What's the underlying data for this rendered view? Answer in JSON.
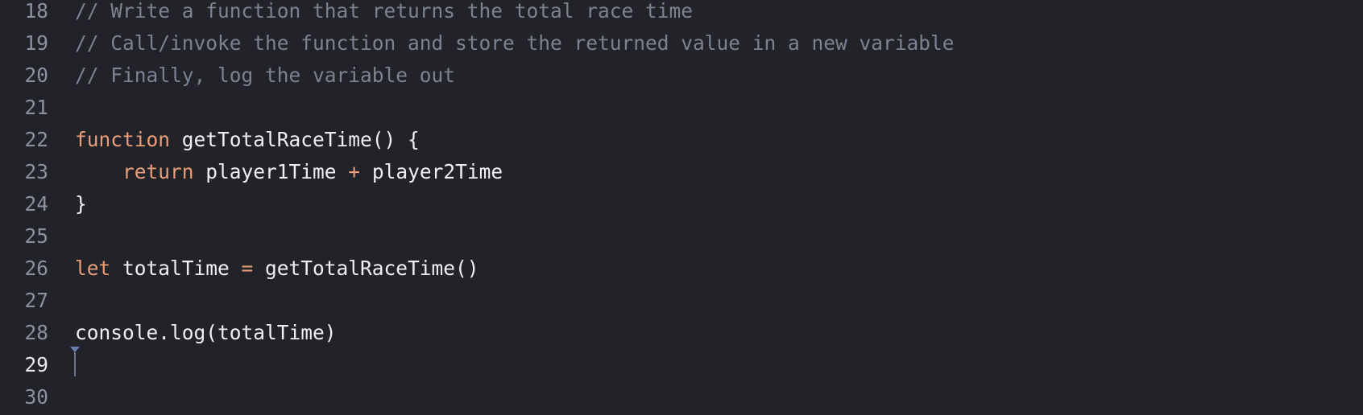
{
  "editor": {
    "lines": [
      {
        "number": "18",
        "tokens": [
          {
            "type": "comment",
            "text": "// Write a function that returns the total race time"
          }
        ]
      },
      {
        "number": "19",
        "tokens": [
          {
            "type": "comment",
            "text": "// Call/invoke the function and store the returned value in a new variable"
          }
        ]
      },
      {
        "number": "20",
        "tokens": [
          {
            "type": "comment",
            "text": "// Finally, log the variable out"
          }
        ]
      },
      {
        "number": "21",
        "tokens": []
      },
      {
        "number": "22",
        "tokens": [
          {
            "type": "keyword",
            "text": "function"
          },
          {
            "type": "plain",
            "text": " getTotalRaceTime() {"
          }
        ]
      },
      {
        "number": "23",
        "tokens": [
          {
            "type": "plain",
            "text": "    "
          },
          {
            "type": "keyword",
            "text": "return"
          },
          {
            "type": "plain",
            "text": " player1Time "
          },
          {
            "type": "operator",
            "text": "+"
          },
          {
            "type": "plain",
            "text": " player2Time"
          }
        ]
      },
      {
        "number": "24",
        "tokens": [
          {
            "type": "plain",
            "text": "}"
          }
        ]
      },
      {
        "number": "25",
        "tokens": []
      },
      {
        "number": "26",
        "tokens": [
          {
            "type": "keyword",
            "text": "let"
          },
          {
            "type": "plain",
            "text": " totalTime "
          },
          {
            "type": "operator",
            "text": "="
          },
          {
            "type": "plain",
            "text": " getTotalRaceTime()"
          }
        ]
      },
      {
        "number": "27",
        "tokens": []
      },
      {
        "number": "28",
        "tokens": [
          {
            "type": "plain",
            "text": "console.log(totalTime)"
          }
        ]
      },
      {
        "number": "29",
        "tokens": [],
        "active": true
      },
      {
        "number": "30",
        "tokens": []
      }
    ],
    "colors": {
      "background": "#212329",
      "comment": "#7b8391",
      "keyword": "#e99d78",
      "text": "#eef0f3",
      "line_number": "#8b919f"
    }
  }
}
